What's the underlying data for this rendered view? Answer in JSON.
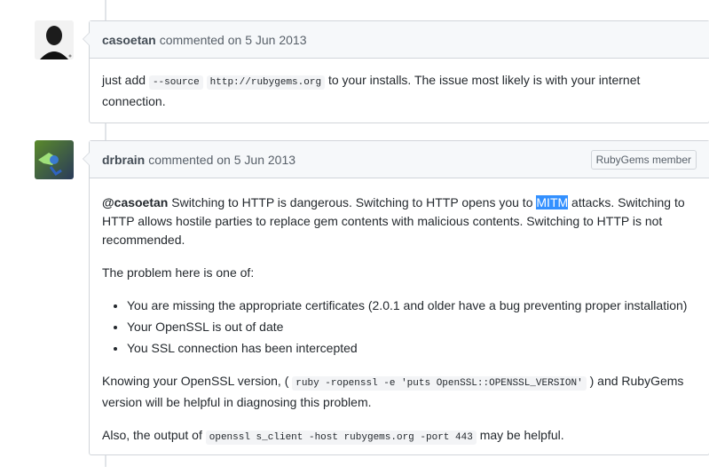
{
  "comments": [
    {
      "author": "casoetan",
      "action": "commented on 5 Jun 2013",
      "body": {
        "pre": "just add ",
        "code1": "--source",
        "link": "http://rubygems.org",
        "post": " to your installs. The issue most likely is with your internet connection."
      }
    },
    {
      "author": "drbrain",
      "action": "commented on 5 Jun 2013",
      "badge": "RubyGems member",
      "body": {
        "mention": "@casoetan",
        "p1_a": " Switching to HTTP is dangerous. Switching to HTTP opens you to ",
        "p1_highlight": "MITM",
        "p1_b": " attacks. Switching to HTTP allows hostile parties to replace gem contents with malicious contents. Switching to HTTP is not recommended.",
        "p2": "The problem here is one of:",
        "list": [
          "You are missing the appropriate certificates (2.0.1 and older have a bug preventing proper installation)",
          "Your OpenSSL is out of date",
          "You SSL connection has been intercepted"
        ],
        "p3_a": "Knowing your OpenSSL version, (",
        "p3_code": "ruby -ropenssl -e 'puts OpenSSL::OPENSSL_VERSION'",
        "p3_b": ") and RubyGems version will be helpful in diagnosing this problem.",
        "p4_a": "Also, the output of ",
        "p4_code": "openssl s_client -host rubygems.org -port 443",
        "p4_b": " may be helpful."
      }
    }
  ]
}
